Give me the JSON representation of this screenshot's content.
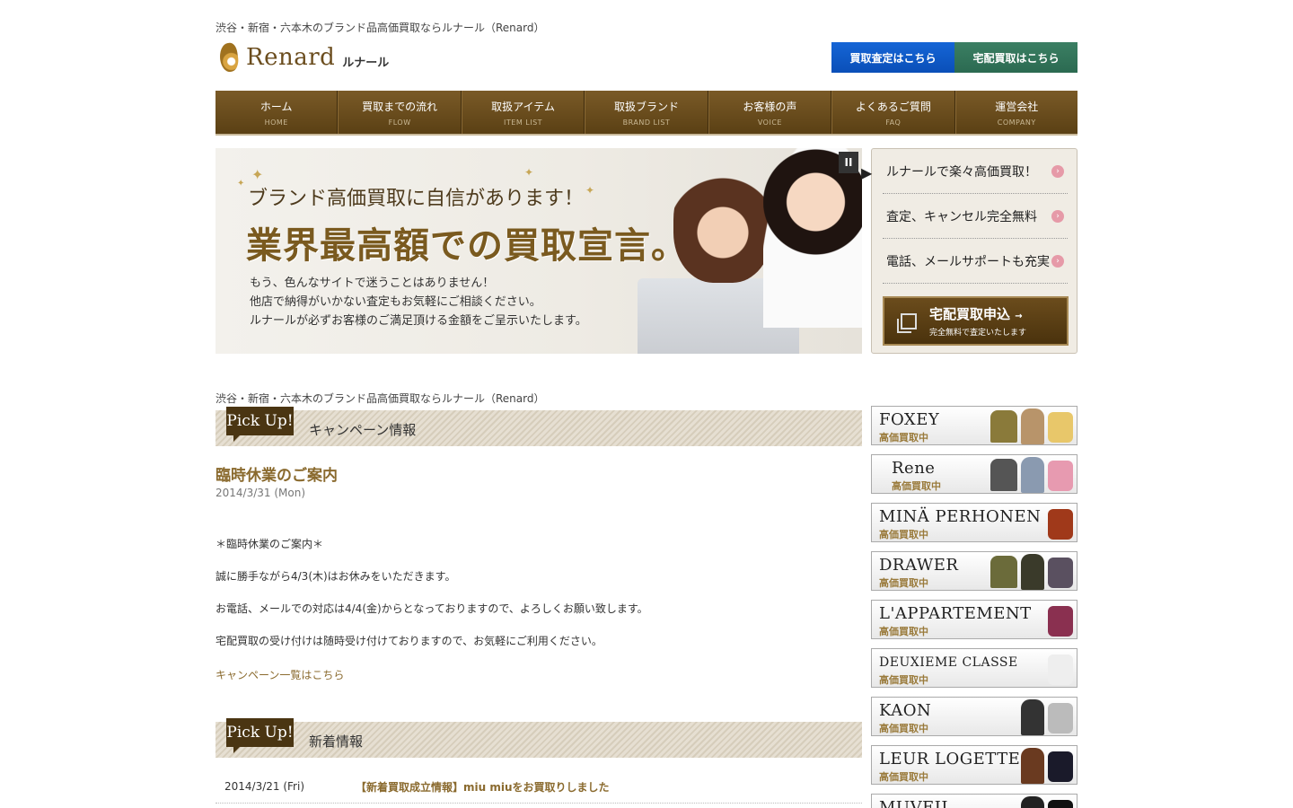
{
  "header": {
    "tagline": "渋谷・新宿・六本木のブランド品高価買取ならルナール（Renard）",
    "logo_text": "Renard",
    "logo_kana": "ルナール",
    "btn_assess": "買取査定はこちら",
    "btn_delivery": "宅配買取はこちら"
  },
  "nav": [
    {
      "jp": "ホーム",
      "en": "HOME"
    },
    {
      "jp": "買取までの流れ",
      "en": "FLOW"
    },
    {
      "jp": "取扱アイテム",
      "en": "ITEM LIST"
    },
    {
      "jp": "取扱ブランド",
      "en": "BRAND LIST"
    },
    {
      "jp": "お客様の声",
      "en": "VOICE"
    },
    {
      "jp": "よくあるご質問",
      "en": "FAQ"
    },
    {
      "jp": "運営会社",
      "en": "COMPANY"
    }
  ],
  "hero": {
    "sub": "ブランド高価買取に自信があります！",
    "main": "業界最高額での買取宣言。",
    "body1": "もう、色んなサイトで迷うことはありません！",
    "body2": "他店で納得がいかない査定もお気軽にご相談ください。",
    "body3": "ルナールが必ずお客様のご満足頂ける金額をご呈示いたします。",
    "pause": "II"
  },
  "side_menu": {
    "items": [
      "ルナールで楽々高価買取！",
      "査定、キャンセル完全無料",
      "電話、メールサポートも充実"
    ],
    "cta_title": "宅配買取申込",
    "cta_sub": "完全無料で査定いたします"
  },
  "content": {
    "tagline": "渋谷・新宿・六本木のブランド品高価買取ならルナール（Renard）",
    "pickup_badge": "Pick Up!",
    "campaign_title": "キャンペーン情報",
    "news_heading": "臨時休業のご案内",
    "news_date": "2014/3/31 (Mon)",
    "news_p1": "＊臨時休業のご案内＊",
    "news_p2": "誠に勝手ながら4/3(木)はお休みをいただきます。",
    "news_p3": "お電話、メールでの対応は4/4(金)からとなっておりますので、よろしくお願い致します。",
    "news_p4": "宅配買取の受け付けは随時受け付けておりますので、お気軽にご利用ください。",
    "campaign_link": "キャンペーン一覧はこちら",
    "new_title": "新着情報",
    "new_date": "2014/3/21 (Fri)",
    "new_text": "【新着買取成立情報】miu miuをお買取りしました"
  },
  "brands": [
    {
      "name": "FOXEY",
      "sub": "高価買取中",
      "c1": "#8a7a3a",
      "c2": "#b8946a",
      "c3": "#e8c76a"
    },
    {
      "name": "Rene",
      "sub": "高価買取中",
      "c1": "#555",
      "c2": "#8a9ab0",
      "c3": "#e79ab0"
    },
    {
      "name": "MINÄ PERHONEN",
      "sub": "高価買取中",
      "c1": "#fff",
      "c2": "#fff",
      "c3": "#a0391a"
    },
    {
      "name": "DRAWER",
      "sub": "高価買取中",
      "c1": "#6b6b3a",
      "c2": "#3a3a2a",
      "c3": "#5a5060"
    },
    {
      "name": "L'APPARTEMENT",
      "sub": "高価買取中",
      "c1": "#fff",
      "c2": "#fff",
      "c3": "#8a3050"
    },
    {
      "name": "DEUXIEME CLASSE",
      "sub": "高価買取中",
      "c1": "#fff",
      "c2": "#ddd",
      "c3": "#eee"
    },
    {
      "name": "KAON",
      "sub": "高価買取中",
      "c1": "#fff",
      "c2": "#333",
      "c3": "#bbb"
    },
    {
      "name": "LEUR LOGETTE",
      "sub": "高価買取中",
      "c1": "#fff",
      "c2": "#6a3a20",
      "c3": "#1a1a2a"
    },
    {
      "name": "MUVEIL",
      "sub": "",
      "c1": "#fff",
      "c2": "#222",
      "c3": "#111"
    }
  ]
}
